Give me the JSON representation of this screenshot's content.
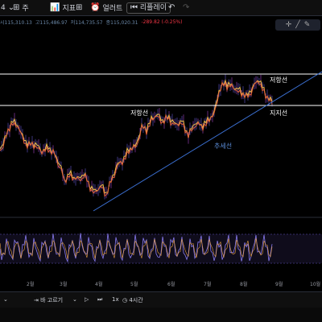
{
  "toolbar": {
    "prefix": "4",
    "chart_type_label": "주",
    "indicators_label": "지표",
    "alert_label": "얼러트",
    "replay_label": "리플레이",
    "undo_icon": "undo-icon",
    "redo_icon": "redo-icon"
  },
  "ohlc": {
    "open": "시115,310.13",
    "high": "고115,486.97",
    "low": "저114,735.57",
    "close": "종115,020.31",
    "change": "-289.82 (-0.25%)"
  },
  "annotations": {
    "resistance_right": "저항선",
    "resistance_left": "저항선",
    "support": "지지선",
    "trendline": "추세선"
  },
  "time_axis": [
    "2월",
    "3월",
    "4월",
    "5월",
    "6월",
    "7월",
    "8월",
    "9월",
    "10월"
  ],
  "bottom_bar": {
    "bar_magnifier_label": "바 고르기",
    "speed_label": "1x",
    "interval_label": "4시간"
  },
  "colors": {
    "background": "#000000",
    "trendline": "#3b6fd1",
    "horizontal_lines": "#ffffff",
    "price_line_gradient": [
      "#f0c040",
      "#e06030",
      "#b040c0",
      "#6050e0"
    ],
    "oscillator_band": "#6a5acd"
  }
}
